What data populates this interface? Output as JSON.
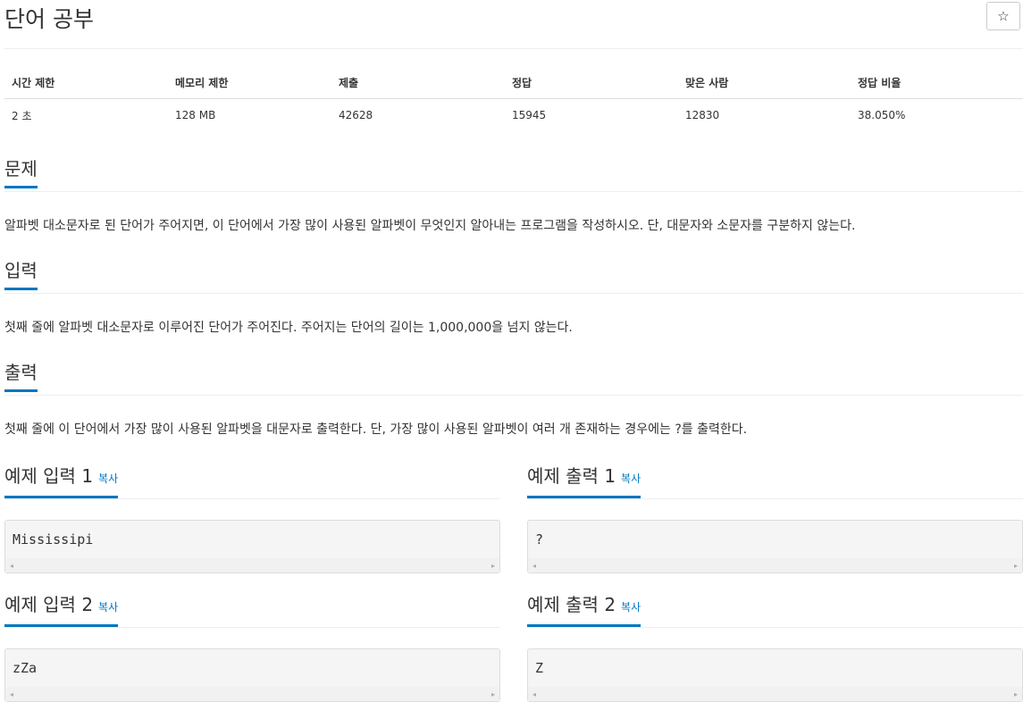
{
  "problem": {
    "title": "단어 공부",
    "star": "☆"
  },
  "info": {
    "headers": [
      "시간 제한",
      "메모리 제한",
      "제출",
      "정답",
      "맞은 사람",
      "정답 비율"
    ],
    "values": [
      "2 초",
      "128 MB",
      "42628",
      "15945",
      "12830",
      "38.050%"
    ]
  },
  "sections": {
    "description": {
      "title": "문제",
      "text": "알파벳 대소문자로 된 단어가 주어지면, 이 단어에서 가장 많이 사용된 알파벳이 무엇인지 알아내는 프로그램을 작성하시오. 단, 대문자와 소문자를 구분하지 않는다."
    },
    "input": {
      "title": "입력",
      "text": "첫째 줄에 알파벳 대소문자로 이루어진 단어가 주어진다. 주어지는 단어의 길이는 1,000,000을 넘지 않는다."
    },
    "output": {
      "title": "출력",
      "text": "첫째 줄에 이 단어에서 가장 많이 사용된 알파벳을 대문자로 출력한다. 단, 가장 많이 사용된 알파벳이 여러 개 존재하는 경우에는 ?를 출력한다."
    }
  },
  "samples": {
    "copy_label": "복사",
    "in1": {
      "title": "예제 입력 1",
      "code": "Mississipi"
    },
    "out1": {
      "title": "예제 출력 1",
      "code": "?"
    },
    "in2": {
      "title": "예제 입력 2",
      "code": "zZa"
    },
    "out2": {
      "title": "예제 출력 2",
      "code": "Z"
    }
  },
  "icons": {
    "scroll_left": "◂",
    "scroll_right": "▸"
  },
  "colors": {
    "accent": "#0076c0"
  }
}
